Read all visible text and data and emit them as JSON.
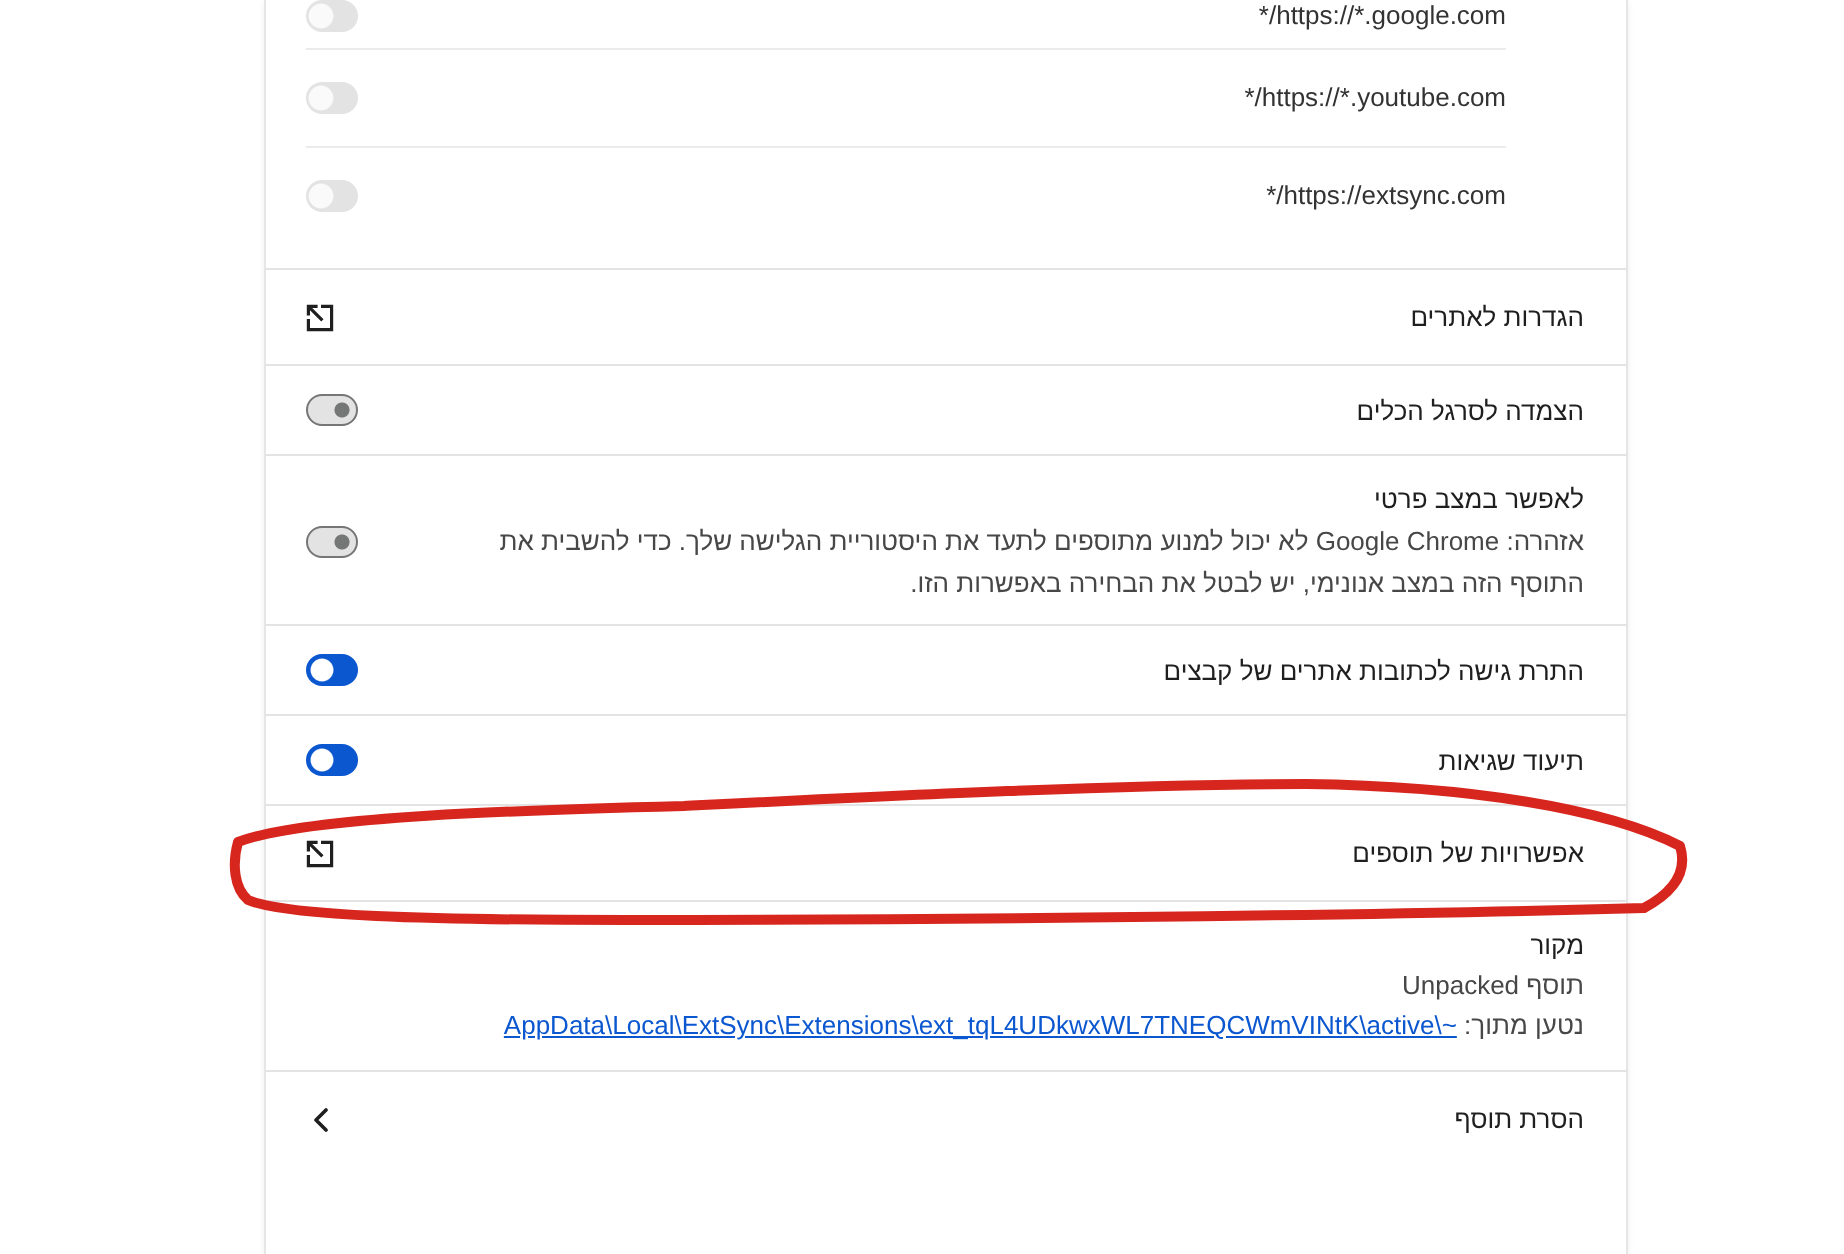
{
  "site_access_list": [
    {
      "url": "*/https://*.google.com",
      "on": true,
      "disabled": true
    },
    {
      "url": "*/https://*.youtube.com",
      "on": true,
      "disabled": true
    },
    {
      "url": "*/https://extsync.com",
      "on": true,
      "disabled": true
    }
  ],
  "settings": [
    {
      "kind": "link",
      "label": "הגדרות לאתרים",
      "circled": false
    },
    {
      "kind": "toggle",
      "label": "הצמדה לסרגל הכלים",
      "on": false,
      "circled": false
    },
    {
      "kind": "toggle",
      "label": "לאפשר במצב פרטי",
      "description": "אזהרה: Google Chrome לא יכול למנוע מתוספים לתעד את היסטוריית הגלישה שלך. כדי להשבית את התוסף הזה במצב אנונימי, יש לבטל את הבחירה באפשרות הזו.",
      "on": false,
      "circled": false
    },
    {
      "kind": "toggle",
      "label": "התרת גישה לכתובות אתרים של קבצים",
      "on": true,
      "circled": false
    },
    {
      "kind": "toggle",
      "label": "תיעוד שגיאות",
      "on": true,
      "circled": false
    },
    {
      "kind": "link",
      "label": "אפשרויות של תוספים",
      "circled": true
    }
  ],
  "source": {
    "heading": "מקור",
    "type": "תוסף Unpacked",
    "loaded_from_label": "נטען מתוך:",
    "path": "AppData\\Local\\ExtSync\\Extensions\\ext_tqL4UDkwxWL7TNEQCWmVINtK\\active\\~"
  },
  "remove_extension": {
    "label": "הסרת תוסף"
  }
}
